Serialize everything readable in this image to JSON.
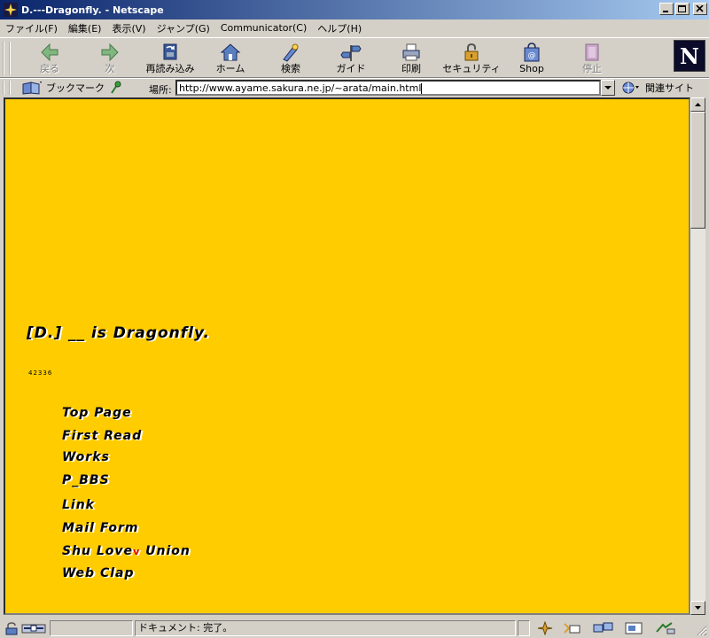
{
  "window": {
    "title": "D.---Dragonfly. - Netscape"
  },
  "menu": [
    "ファイル(F)",
    "編集(E)",
    "表示(V)",
    "ジャンプ(G)",
    "Communicator(C)",
    "ヘルプ(H)"
  ],
  "toolbar": {
    "buttons": [
      {
        "label": "戻る",
        "icon": "back-arrow-icon",
        "enabled": false
      },
      {
        "label": "次",
        "icon": "forward-arrow-icon",
        "enabled": false
      },
      {
        "label": "再読み込み",
        "icon": "reload-icon",
        "enabled": true
      },
      {
        "label": "ホーム",
        "icon": "home-icon",
        "enabled": true
      },
      {
        "label": "検索",
        "icon": "search-icon",
        "enabled": true
      },
      {
        "label": "ガイド",
        "icon": "guide-icon",
        "enabled": true
      },
      {
        "label": "印刷",
        "icon": "print-icon",
        "enabled": true
      },
      {
        "label": "セキュリティ",
        "icon": "security-icon",
        "enabled": true
      },
      {
        "label": "Shop",
        "icon": "shop-icon",
        "enabled": true
      },
      {
        "label": "停止",
        "icon": "stop-icon",
        "enabled": false
      }
    ],
    "logo": "N"
  },
  "location": {
    "bookmark_label": "ブックマーク",
    "field_label": "場所:",
    "url": "http://www.ayame.sakura.ne.jp/~arata/main.html",
    "related_label": "関連サイト"
  },
  "page": {
    "title": "[D.] __ is Dragonfly.",
    "counter": "42336",
    "links": [
      "Top Page",
      "First Read",
      "Works",
      "P_BBS",
      "Link",
      "Mail Form",
      "Shu Love",
      "Union",
      "Web Clap"
    ],
    "heart": "v"
  },
  "status": {
    "text": "ドキュメント: 完了。"
  },
  "colors": {
    "page_background": "#ffcc00",
    "title_bar": "#0a246a",
    "chrome": "#d4d0c8"
  }
}
